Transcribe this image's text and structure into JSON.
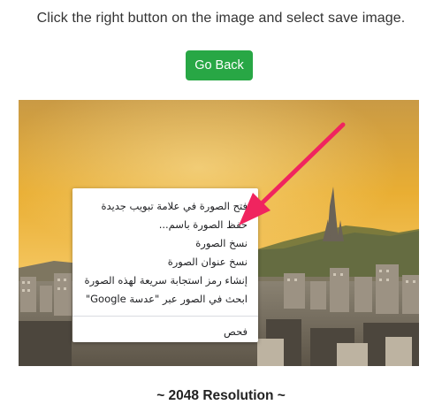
{
  "instruction": "Click the right button on the image and select save image.",
  "go_back_label": "Go Back",
  "photo": {
    "sky_top": "#d9a43a",
    "sky_mid": "#ecb233",
    "sky_low": "#f2c866",
    "city": "#7b6f62"
  },
  "context_menu": {
    "items": [
      "فتح الصورة في علامة تبويب جديدة",
      "حفظ الصورة باسم...",
      "نسخ الصورة",
      "نسخ عنوان الصورة",
      "إنشاء رمز استجابة سريعة لهذه الصورة",
      "ابحث في الصور عبر \"عدسة Google\""
    ],
    "inspect": "فحص"
  },
  "arrow_color": "#f0245f",
  "caption": "~ 2048 Resolution ~"
}
